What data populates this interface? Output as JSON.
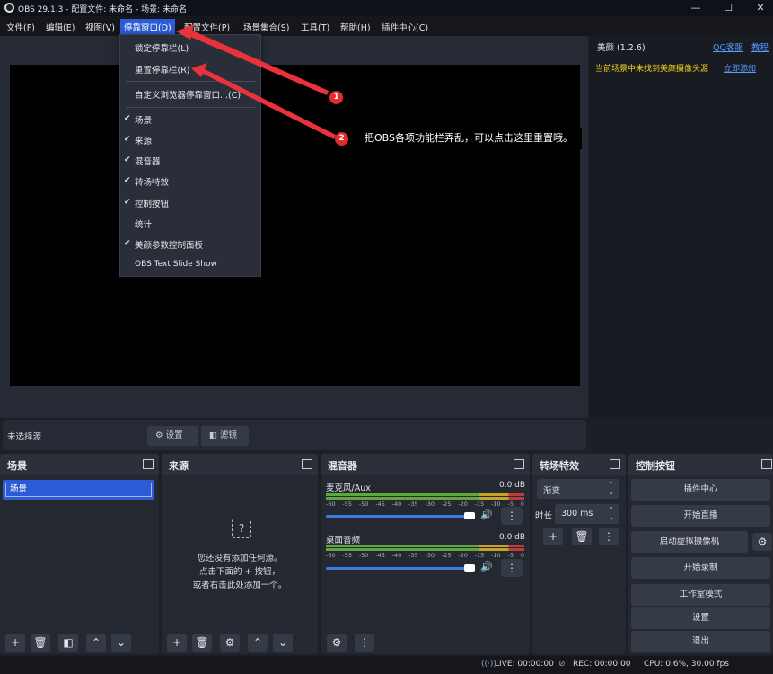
{
  "window": {
    "title": "OBS 29.1.3 - 配置文件: 未命名 - 场景: 未命名",
    "minimize": "—",
    "maximize": "☐",
    "close": "✕"
  },
  "menubar": [
    "文件(F)",
    "编辑(E)",
    "视图(V)",
    "停靠窗口(D)",
    "配置文件(P)",
    "场景集合(S)",
    "工具(T)",
    "帮助(H)",
    "插件中心(C)"
  ],
  "dropdown": {
    "lock_docks": "锁定停靠栏(L)",
    "reset_docks": "重置停靠栏(R)",
    "custom_browser_docks": "自定义浏览器停靠窗口...(C)",
    "items": [
      {
        "label": "场景",
        "checked": true
      },
      {
        "label": "来源",
        "checked": true
      },
      {
        "label": "混音器",
        "checked": true
      },
      {
        "label": "转场特效",
        "checked": true
      },
      {
        "label": "控制按钮",
        "checked": true
      },
      {
        "label": "统计",
        "checked": false
      },
      {
        "label": "美颜参数控制面板",
        "checked": true
      },
      {
        "label": "OBS Text Slide Show",
        "checked": false
      }
    ]
  },
  "annotations": {
    "badge1": "1",
    "badge2": "2",
    "callout": "把OBS各项功能栏弄乱，可以点击这里重置哦。"
  },
  "beauty_panel": {
    "title": "美颜 (1.2.6)",
    "qq_service": "QQ客服",
    "tutorial": "教程",
    "notice": "当前场景中未找到美颜摄像头源",
    "add_now": "立即添加"
  },
  "source_toolbar": {
    "no_source": "未选择源",
    "settings": "设置",
    "filters": "滤镜"
  },
  "scenes": {
    "title": "场景",
    "items": [
      "场景"
    ]
  },
  "sources": {
    "title": "来源",
    "empty_line1": "您还没有添加任何源。",
    "empty_line2": "点击下面的 + 按钮，",
    "empty_line3": "或者右击此处添加一个。"
  },
  "mixer": {
    "title": "混音器",
    "ticks": [
      "-60",
      "-55",
      "-50",
      "-45",
      "-40",
      "-35",
      "-30",
      "-25",
      "-20",
      "-15",
      "-10",
      "-5",
      "0"
    ],
    "channels": [
      {
        "name": "麦克风/Aux",
        "level": "0.0 dB",
        "volume": 1.0
      },
      {
        "name": "桌面音频",
        "level": "0.0 dB",
        "volume": 1.0
      }
    ]
  },
  "transitions": {
    "title": "转场特效",
    "selected": "渐变",
    "duration_label": "时长",
    "duration": "300 ms"
  },
  "controls": {
    "title": "控制按钮",
    "buttons": [
      "插件中心",
      "开始直播",
      "启动虚拟摄像机",
      "开始录制",
      "工作室模式",
      "设置",
      "退出"
    ]
  },
  "status": {
    "live": "LIVE: 00:00:00",
    "rec": "REC: 00:00:00",
    "cpu": "CPU: 0.6%, 30.00 fps"
  },
  "colors": {
    "accent": "#2d5bd6",
    "badge": "#e32b2b",
    "link": "#5a9cff",
    "warning": "#f2d21c",
    "arrow": "#e8323c"
  }
}
